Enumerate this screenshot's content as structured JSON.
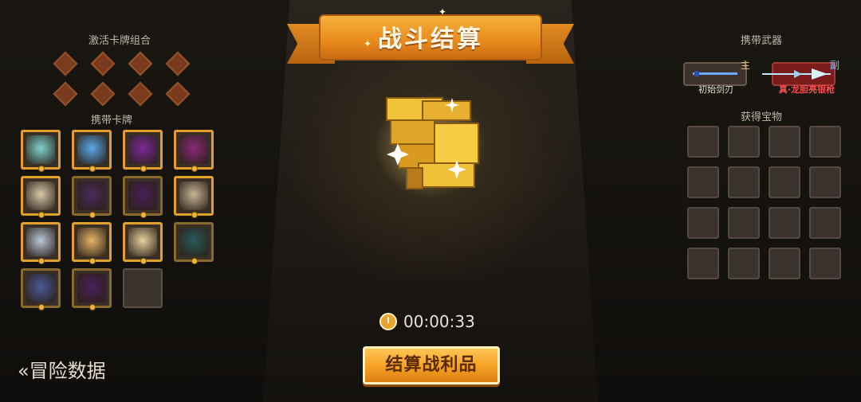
{
  "banner": {
    "title": "战斗结算"
  },
  "left": {
    "combos_title": "激活卡牌组合",
    "cards_title": "携带卡牌",
    "cards": [
      {
        "name": "card-1",
        "color": "#7fd4d0",
        "frame": "gold",
        "filled": true
      },
      {
        "name": "card-2",
        "color": "#5aa8e8",
        "frame": "gold",
        "filled": true
      },
      {
        "name": "card-3",
        "color": "#7a2a9a",
        "frame": "gold",
        "filled": true
      },
      {
        "name": "card-4",
        "color": "#8a2a7a",
        "frame": "gold",
        "filled": true
      },
      {
        "name": "card-5",
        "color": "#d9c9a8",
        "frame": "gold",
        "filled": true
      },
      {
        "name": "card-6",
        "color": "#4a2a5a",
        "frame": "dim",
        "filled": true
      },
      {
        "name": "card-7",
        "color": "#4a1f5a",
        "frame": "dim",
        "filled": true
      },
      {
        "name": "card-8",
        "color": "#c7b494",
        "frame": "gold",
        "filled": true
      },
      {
        "name": "card-9",
        "color": "#b9c7d8",
        "frame": "gold",
        "filled": true
      },
      {
        "name": "card-10",
        "color": "#e6b66a",
        "frame": "gold",
        "filled": true
      },
      {
        "name": "card-11",
        "color": "#e8d2a0",
        "frame": "gold",
        "filled": true
      },
      {
        "name": "card-12",
        "color": "#2a5a5a",
        "frame": "dim",
        "filled": true
      },
      {
        "name": "card-13",
        "color": "#4a5a9a",
        "frame": "dim",
        "filled": true
      },
      {
        "name": "card-14",
        "color": "#4a1f5a",
        "frame": "dim",
        "filled": true
      },
      {
        "name": "card-15",
        "color": "#3b342d",
        "frame": "empty",
        "filled": false
      }
    ]
  },
  "right": {
    "weapons_title": "携带武器",
    "main_tag": "主",
    "sub_tag": "副",
    "main_weapon": "初始剑刃",
    "sub_weapon": "真·龙胆亮银枪",
    "treasure_title": "获得宝物"
  },
  "timer": "00:00:33",
  "loot_button": "结算战利品",
  "back_link": "«冒险数据",
  "colors": {
    "accent_orange": "#f5a023",
    "sub_weapon_red": "#ff4b4b"
  }
}
